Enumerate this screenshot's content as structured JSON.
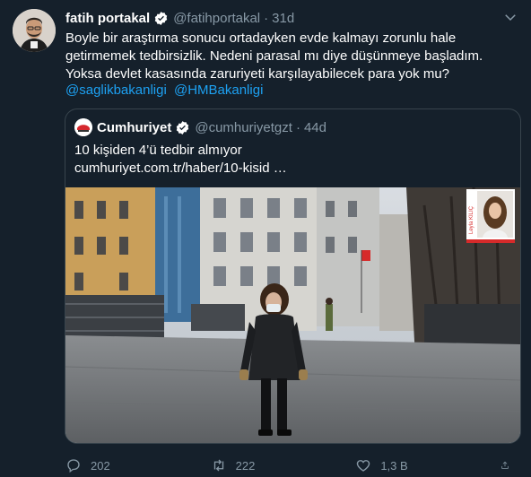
{
  "tweet": {
    "author_name": "fatih portakal",
    "author_handle": "@fatihportakal",
    "separator": "·",
    "time": "31d",
    "text_lines": [
      "Boyle bir araştırma sonucu ortadayken evde kalmayı zorunlu hale",
      "getirmemek tedbirsizlik. Nedeni parasal mı diye düşünmeye başladım.",
      "Yoksa devlet kasasında zaruriyeti karşılayabilecek para yok mu?"
    ],
    "mentions": [
      "@saglikbakanligi",
      "@HMBakanligi"
    ]
  },
  "quote": {
    "author_name": "Cumhuriyet",
    "author_handle": "@cumhuriyetgzt",
    "separator": "·",
    "time": "44d",
    "text_line1": "10 kişiden 4’ü tedbir almıyor",
    "text_line2": "cumhuriyet.com.tr/haber/10-kisid …",
    "image_inset_caption": "Leyla KILIÇ"
  },
  "actions": {
    "reply_count": "202",
    "retweet_count": "222",
    "like_count": "1,3 B"
  },
  "colors": {
    "background": "#15202b",
    "text": "#ffffff",
    "muted": "#8899a6",
    "link": "#1da1f2",
    "border": "#38444d"
  }
}
